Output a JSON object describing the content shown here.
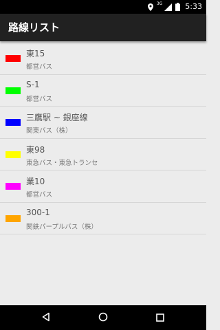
{
  "status_bar": {
    "network_label": "3G",
    "time": "5:33",
    "icons": [
      "location-icon",
      "signal-icon",
      "battery-icon"
    ]
  },
  "app_bar": {
    "title": "路線リスト"
  },
  "routes": [
    {
      "name": "東15",
      "operator": "都営バス",
      "color": "#ff0000"
    },
    {
      "name": "S-1",
      "operator": "都営バス",
      "color": "#00ff00"
    },
    {
      "name": "三鷹駅 ~ 銀座線",
      "operator": "関東バス（株）",
      "color": "#0000ff"
    },
    {
      "name": "東98",
      "operator": "東急バス・東急トランセ",
      "color": "#ffff00"
    },
    {
      "name": "業10",
      "operator": "都営バス",
      "color": "#ff00ff"
    },
    {
      "name": "300-1",
      "operator": "関鉄パープルバス（株）",
      "color": "#ffa500"
    }
  ],
  "nav_bar": {
    "icons": [
      "back-icon",
      "home-icon",
      "recents-icon"
    ]
  }
}
